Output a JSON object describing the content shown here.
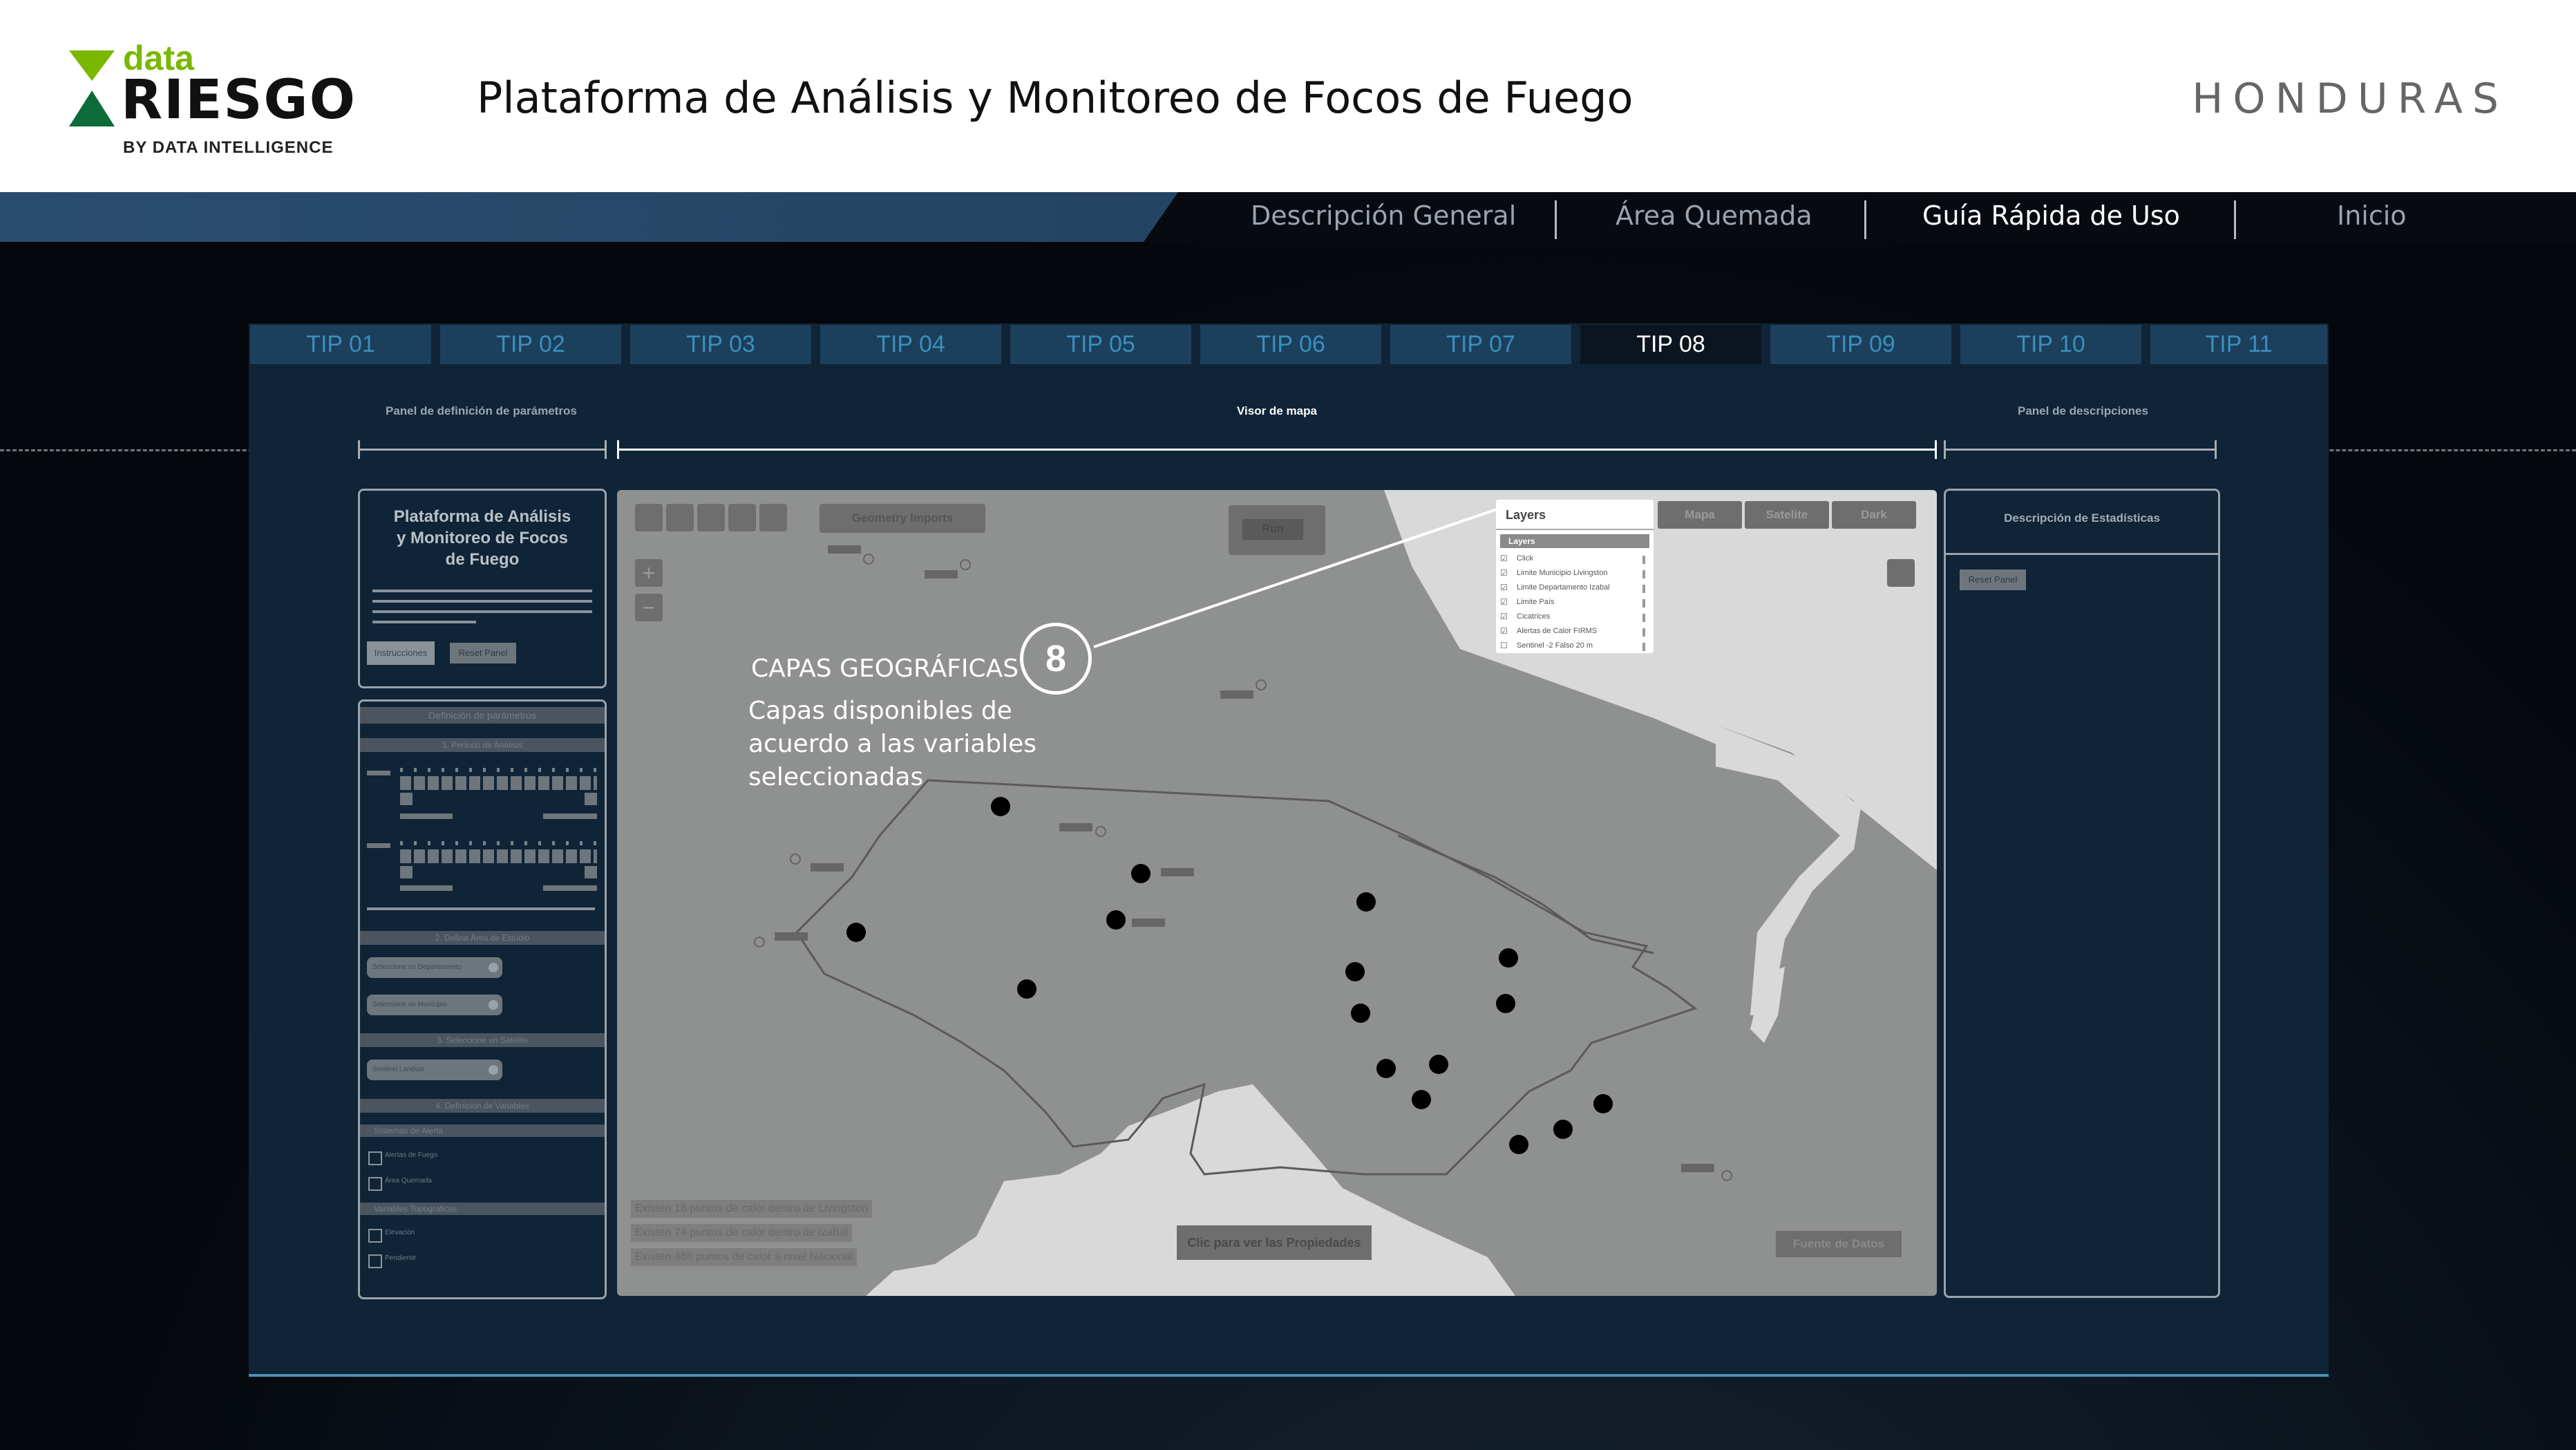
{
  "header": {
    "logo": {
      "data": "data",
      "riesgo": "RIESGO",
      "by": "BY DATA INTELLIGENCE"
    },
    "title": "Plataforma de Análisis y Monitoreo de Focos de Fuego",
    "country": "HONDURAS"
  },
  "nav": {
    "items": [
      "Descripción General",
      "Área Quemada",
      "Guía Rápida de Uso",
      "Inicio"
    ],
    "active": "Guía Rápida de Uso"
  },
  "tips": [
    "TIP 01",
    "TIP 02",
    "TIP 03",
    "TIP 04",
    "TIP 05",
    "TIP 06",
    "TIP 07",
    "TIP 08",
    "TIP 09",
    "TIP 10",
    "TIP 11"
  ],
  "active_tip": "TIP 08",
  "sections": {
    "left": "Panel de definición de parámetros",
    "center": "Visor de mapa",
    "right": "Panel de descripciones"
  },
  "left_panel": {
    "title": "Plataforma de Análisis y Monitoreo de Focos de Fuego",
    "btn_instrucciones": "Instrucciones",
    "btn_reset": "Reset Panel",
    "section_params": "Definición de parámetros",
    "s1": "1. Período de Análisis",
    "s2": "2. Defina Área de Estudio",
    "sel_depto": "Seleccione un Departamento",
    "sel_muni": "Seleccione un Municipio",
    "s3": "3. Seleccione un Satélite",
    "sel_sat": "Sentinel Landsat",
    "s4": "4. Definición de Variables",
    "alert_systems": "Sistemas de Alerta",
    "alertas_fuego": "Alertas de Fuego",
    "area_quemada": "Área Quemada",
    "topo_vars": "Variables Topográficas",
    "elevacion": "Elevación",
    "pendiente": "Pendiente"
  },
  "map": {
    "btn_geometry": "Geometry Imports",
    "btn_run": "Run",
    "basemaps": [
      "Mapa",
      "Satelite",
      "Dark"
    ],
    "zoom_in": "+",
    "zoom_out": "−",
    "layers": {
      "title": "Layers",
      "header": "Layers",
      "items": [
        {
          "label": "Click",
          "checked": true
        },
        {
          "label": "Limite Municipio Livingston",
          "checked": true
        },
        {
          "label": "Limite Departamento Izabal",
          "checked": true
        },
        {
          "label": "Limite País",
          "checked": true
        },
        {
          "label": "Cicatrices",
          "checked": true
        },
        {
          "label": "Alertas de Calor FIRMS",
          "checked": true
        },
        {
          "label": "Sentinel -2 Falso 20 m",
          "checked": false
        }
      ]
    },
    "stats_lines": [
      "Existen 18 puntos de calor dentro de Livingston",
      "Existen 74 puntos de calor dentro de Izabal",
      "Existen 468 puntos de calor a nivel Nacional"
    ],
    "btn_props": "Clic para ver las Propiedades",
    "btn_source": "Fuente de Datos"
  },
  "callout": {
    "number": "8",
    "heading": "CAPAS GEOGRÁFICAS",
    "body_lines": [
      "Capas disponibles de",
      "acuerdo a las variables",
      "seleccionadas"
    ]
  },
  "right_panel": {
    "title": "Descripción de Estadísticas",
    "btn_reset": "Reset Panel"
  }
}
